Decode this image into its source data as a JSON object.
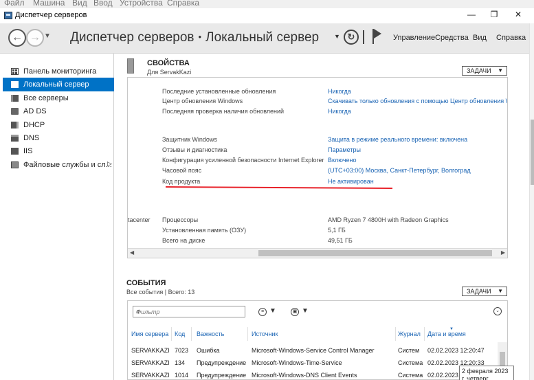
{
  "vm_menubar": {
    "items": [
      "Файл",
      "Машина",
      "Вид",
      "Ввод",
      "Устройства",
      "Справка"
    ]
  },
  "window": {
    "title": "Диспетчер серверов",
    "minimize": "—",
    "maximize": "❐",
    "close": "✕"
  },
  "header": {
    "breadcrumb_root": "Диспетчер серверов",
    "breadcrumb_sep": "•",
    "breadcrumb_current": "Локальный сервер",
    "menus": [
      "Управление",
      "Средства",
      "Вид",
      "Справка"
    ]
  },
  "sidebar": {
    "items": [
      {
        "label": "Панель мониторинга",
        "icon": "dashboard-icon",
        "active": false
      },
      {
        "label": "Локальный сервер",
        "icon": "local-server-icon",
        "active": true
      },
      {
        "label": "Все серверы",
        "icon": "all-servers-icon",
        "active": false
      },
      {
        "label": "AD DS",
        "icon": "ad-ds-icon",
        "active": false
      },
      {
        "label": "DHCP",
        "icon": "dhcp-icon",
        "active": false
      },
      {
        "label": "DNS",
        "icon": "dns-icon",
        "active": false
      },
      {
        "label": "IIS",
        "icon": "iis-icon",
        "active": false
      },
      {
        "label": "Файловые службы и сл...",
        "icon": "file-services-icon",
        "active": false,
        "has_arrow": true
      }
    ]
  },
  "properties": {
    "title": "СВОЙСТВА",
    "subtitle": "Для ServakKazi",
    "tasks_label": "ЗАДАЧИ",
    "cutoff_text": "tacenter",
    "rows": [
      {
        "key": "Последние установленные обновления",
        "value": "Никогда",
        "link": true
      },
      {
        "key": "Центр обновления Windows",
        "value": "Скачивать только обновления с помощью Центр обновления W",
        "link": true
      },
      {
        "key": "Последняя проверка наличия обновлений",
        "value": "Никогда",
        "link": true
      },
      {
        "key": "Защитник Windows",
        "value": "Защита в режиме реального времени: включена",
        "link": true
      },
      {
        "key": "Отзывы и диагностика",
        "value": "Параметры",
        "link": true
      },
      {
        "key": "Конфигурация усиленной безопасности Internet Explorer",
        "value": "Включено",
        "link": true
      },
      {
        "key": "Часовой пояс",
        "value": "(UTC+03:00) Москва, Санкт-Петербург, Волгоград",
        "link": true
      },
      {
        "key": "Код продукта",
        "value": "Не активирован",
        "link": true
      },
      {
        "key": "Процессоры",
        "value": "AMD Ryzen 7 4800H with Radeon Graphics",
        "link": false
      },
      {
        "key": "Установленная память (ОЗУ)",
        "value": "5,1 ГБ",
        "link": false
      },
      {
        "key": "Всего на диске",
        "value": "49,51 ГБ",
        "link": false
      }
    ]
  },
  "events": {
    "title": "СОБЫТИЯ",
    "subtitle": "Все события | Всего: 13",
    "tasks_label": "ЗАДАЧИ",
    "filter_placeholder": "Фильтр",
    "columns": [
      "Имя сервера",
      "Код",
      "Важность",
      "Источник",
      "Журнал",
      "Дата и время"
    ],
    "rows": [
      [
        "SERVAKKAZI",
        "7023",
        "Ошибка",
        "Microsoft-Windows-Service Control Manager",
        "Систем",
        "02.02.2023 12:20:47"
      ],
      [
        "SERVAKKAZI",
        "134",
        "Предупреждение",
        "Microsoft-Windows-Time-Service",
        "Система",
        "02.02.2023 12:20:33"
      ],
      [
        "SERVAKKAZI",
        "1014",
        "Предупреждение",
        "Microsoft-Windows-DNS Client Events",
        "Система",
        "02.02.2023 1"
      ]
    ],
    "tooltip": "2 февраля 2023 г. четверг"
  },
  "colors": {
    "accent": "#0072c6",
    "link": "#1a64b4",
    "annotation": "#e8222a"
  }
}
